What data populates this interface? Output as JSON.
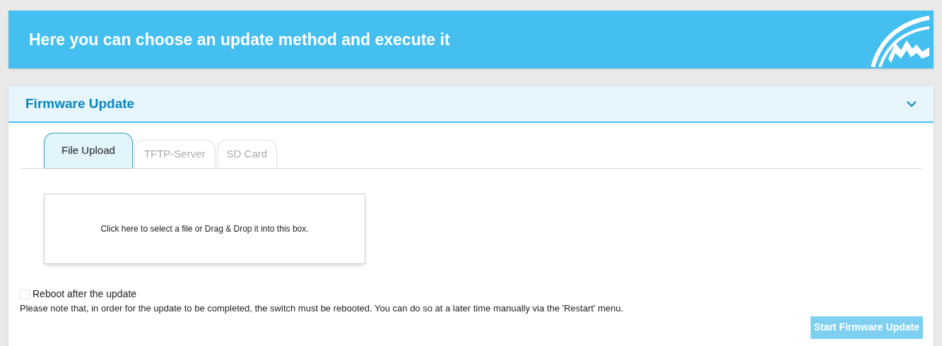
{
  "banner": {
    "title": "Here you can choose an update method and execute it"
  },
  "panel": {
    "title": "Firmware Update",
    "expanded": true,
    "tabs": [
      {
        "label": "File Upload",
        "selected": true
      },
      {
        "label": "TFTP-Server",
        "selected": false
      },
      {
        "label": "SD Card",
        "selected": false
      }
    ],
    "drop_zone": {
      "text": "Click here to select a file or Drag & Drop it into this box."
    },
    "reboot": {
      "label": "Reboot after the update",
      "checked": false
    },
    "note": "Please note that, in order for the update to be completed, the switch must be rebooted. You can do so at a later time manually via the 'Restart' menu.",
    "start_button": {
      "label": "Start Firmware Update",
      "disabled": true
    }
  }
}
